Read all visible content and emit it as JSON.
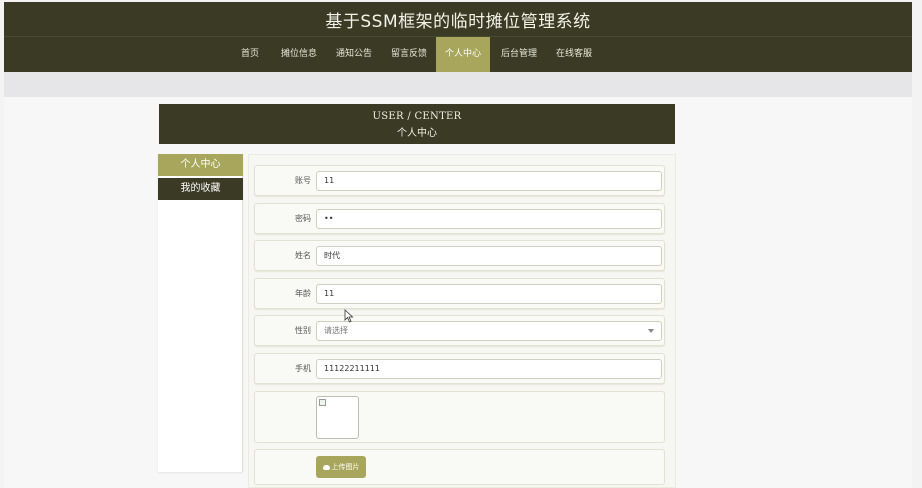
{
  "app": {
    "title": "基于SSM框架的临时摊位管理系统"
  },
  "nav": {
    "items": [
      {
        "label": "首页"
      },
      {
        "label": "摊位信息"
      },
      {
        "label": "通知公告"
      },
      {
        "label": "留言反馈"
      },
      {
        "label": "个人中心"
      },
      {
        "label": "后台管理"
      },
      {
        "label": "在线客服"
      }
    ],
    "active_index": 4
  },
  "banner": {
    "en": "USER / CENTER",
    "zh": "个人中心"
  },
  "sidebar": {
    "items": [
      {
        "label": "个人中心"
      },
      {
        "label": "我的收藏"
      }
    ]
  },
  "form": {
    "account": {
      "label": "账号",
      "value": "11"
    },
    "password": {
      "label": "密码",
      "value": "••"
    },
    "name": {
      "label": "姓名",
      "value": "时代"
    },
    "age": {
      "label": "年龄",
      "value": "11"
    },
    "gender": {
      "label": "性别",
      "value": "请选择"
    },
    "phone": {
      "label": "手机",
      "value": "11122211111"
    },
    "upload_label": "上传图片"
  },
  "colors": {
    "dark": "#3a3a25",
    "accent": "#a7a65c"
  }
}
